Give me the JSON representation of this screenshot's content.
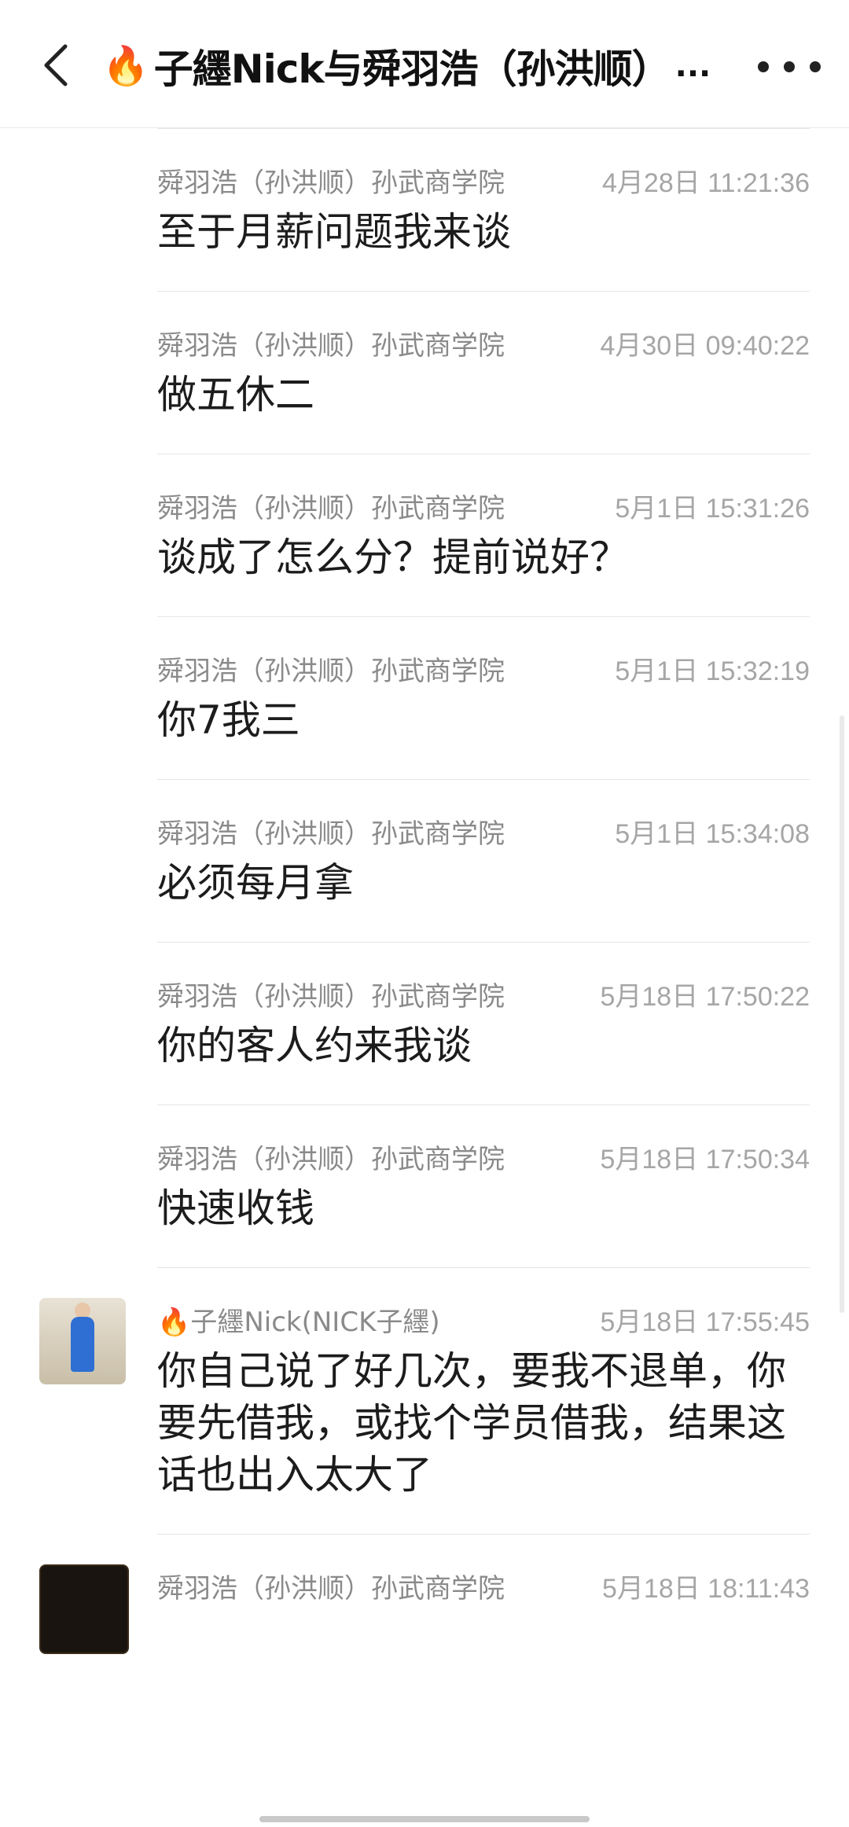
{
  "header": {
    "title": "子纆Nick与舜羽浩（孙洪顺）",
    "ellipsis": "...",
    "back_icon": "chevron-left-icon",
    "more_icon": "more-dots-icon",
    "fire_icon": "🔥"
  },
  "messages": [
    {
      "sender": "舜羽浩（孙洪顺）孙武商学院",
      "time": "4月28日 11:21:36",
      "text": "至于月薪问题我来谈"
    },
    {
      "sender": "舜羽浩（孙洪顺）孙武商学院",
      "time": "4月30日 09:40:22",
      "text": "做五休二"
    },
    {
      "sender": "舜羽浩（孙洪顺）孙武商学院",
      "time": "5月1日 15:31:26",
      "text": "谈成了怎么分？提前说好？"
    },
    {
      "sender": "舜羽浩（孙洪顺）孙武商学院",
      "time": "5月1日 15:32:19",
      "text": "你7我三"
    },
    {
      "sender": "舜羽浩（孙洪顺）孙武商学院",
      "time": "5月1日 15:34:08",
      "text": "必须每月拿"
    },
    {
      "sender": "舜羽浩（孙洪顺）孙武商学院",
      "time": "5月18日 17:50:22",
      "text": "你的客人约来我谈"
    },
    {
      "sender": "舜羽浩（孙洪顺）孙武商学院",
      "time": "5月18日 17:50:34",
      "text": "快速收钱"
    },
    {
      "sender": "子纆Nick(NICK子纆)",
      "sender_icon": "🔥",
      "time": "5月18日 17:55:45",
      "text": "你自己说了好几次，要我不退单，你要先借我，或找个学员借我，结果这话也出入太大了"
    },
    {
      "sender": "舜羽浩（孙洪顺）孙武商学院",
      "time": "5月18日 18:11:43",
      "text": ""
    }
  ]
}
